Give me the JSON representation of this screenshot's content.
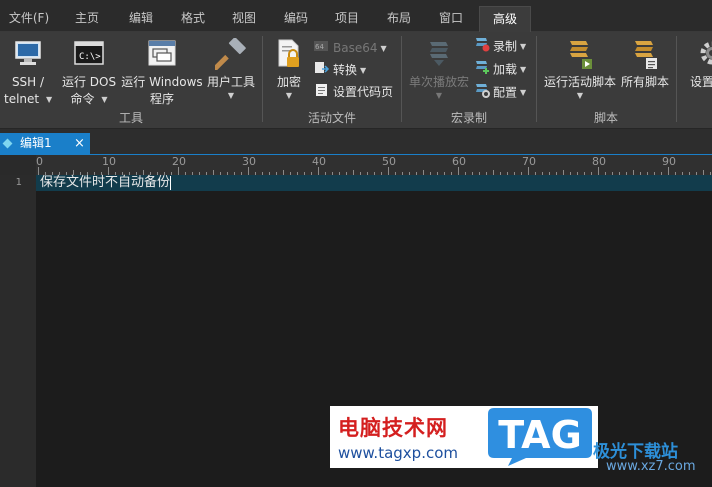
{
  "menu": {
    "tabs": [
      {
        "label": "文件(F)"
      },
      {
        "label": "主页"
      },
      {
        "label": "编辑"
      },
      {
        "label": "格式"
      },
      {
        "label": "视图"
      },
      {
        "label": "编码"
      },
      {
        "label": "项目"
      },
      {
        "label": "布局"
      },
      {
        "label": "窗口"
      },
      {
        "label": "高级",
        "active": true
      }
    ]
  },
  "ribbon": {
    "groups": {
      "tools": "工具",
      "active_file": "活动文件",
      "macro": "宏录制",
      "script": "脚本"
    },
    "ssh": {
      "line1": "SSH /",
      "line2": "telnet"
    },
    "dos": {
      "line1": "运行 DOS",
      "line2": "命令"
    },
    "windows": {
      "line1": "运行 Windows",
      "line2": "程序"
    },
    "user_tools": {
      "line1": "用户工具"
    },
    "encrypt": {
      "line1": "加密"
    },
    "base64": {
      "label": "Base64"
    },
    "convert": {
      "label": "转换"
    },
    "set_codepage": {
      "label": "设置代码页"
    },
    "play_macro": {
      "line1": "单次播放宏"
    },
    "record": {
      "label": "录制"
    },
    "load": {
      "label": "加载"
    },
    "configure": {
      "label": "配置"
    },
    "run_script": {
      "line1": "运行活动脚本"
    },
    "all_scripts": {
      "line1": "所有脚本"
    },
    "settings": {
      "line1": "设置"
    }
  },
  "document": {
    "tab_name": "编辑1",
    "close_glyph": "×",
    "line_number": "1",
    "line_text": "保存文件时不自动备份"
  },
  "ruler": {
    "labels": [
      "0",
      "10",
      "20",
      "30",
      "40",
      "50",
      "60",
      "70",
      "80",
      "90"
    ]
  },
  "watermark": {
    "title": "电脑技术网",
    "url": "www.tagxp.com",
    "tag": "TAG",
    "site": "极光下载站",
    "site_url": "www.xz7.com"
  },
  "colors": {
    "accent": "#1a7fc9",
    "current_line": "#123c4c",
    "ribbon_bg": "#3b3b3b",
    "editor_bg": "#1c1c1c"
  },
  "icons": {
    "ssh": "terminal-icon",
    "dos": "dos-prompt-icon",
    "windows": "window-icon",
    "user_tools": "hammer-icon",
    "encrypt": "lock-document-icon",
    "base64": "base64-icon",
    "convert": "convert-icon",
    "set_codepage": "codepage-icon",
    "play_macro": "play-macro-icon",
    "record": "record-macro-icon",
    "load": "load-macro-icon",
    "configure": "configure-macro-icon",
    "run_script": "script-run-icon",
    "all_scripts": "script-list-icon",
    "settings": "gear-icon"
  }
}
